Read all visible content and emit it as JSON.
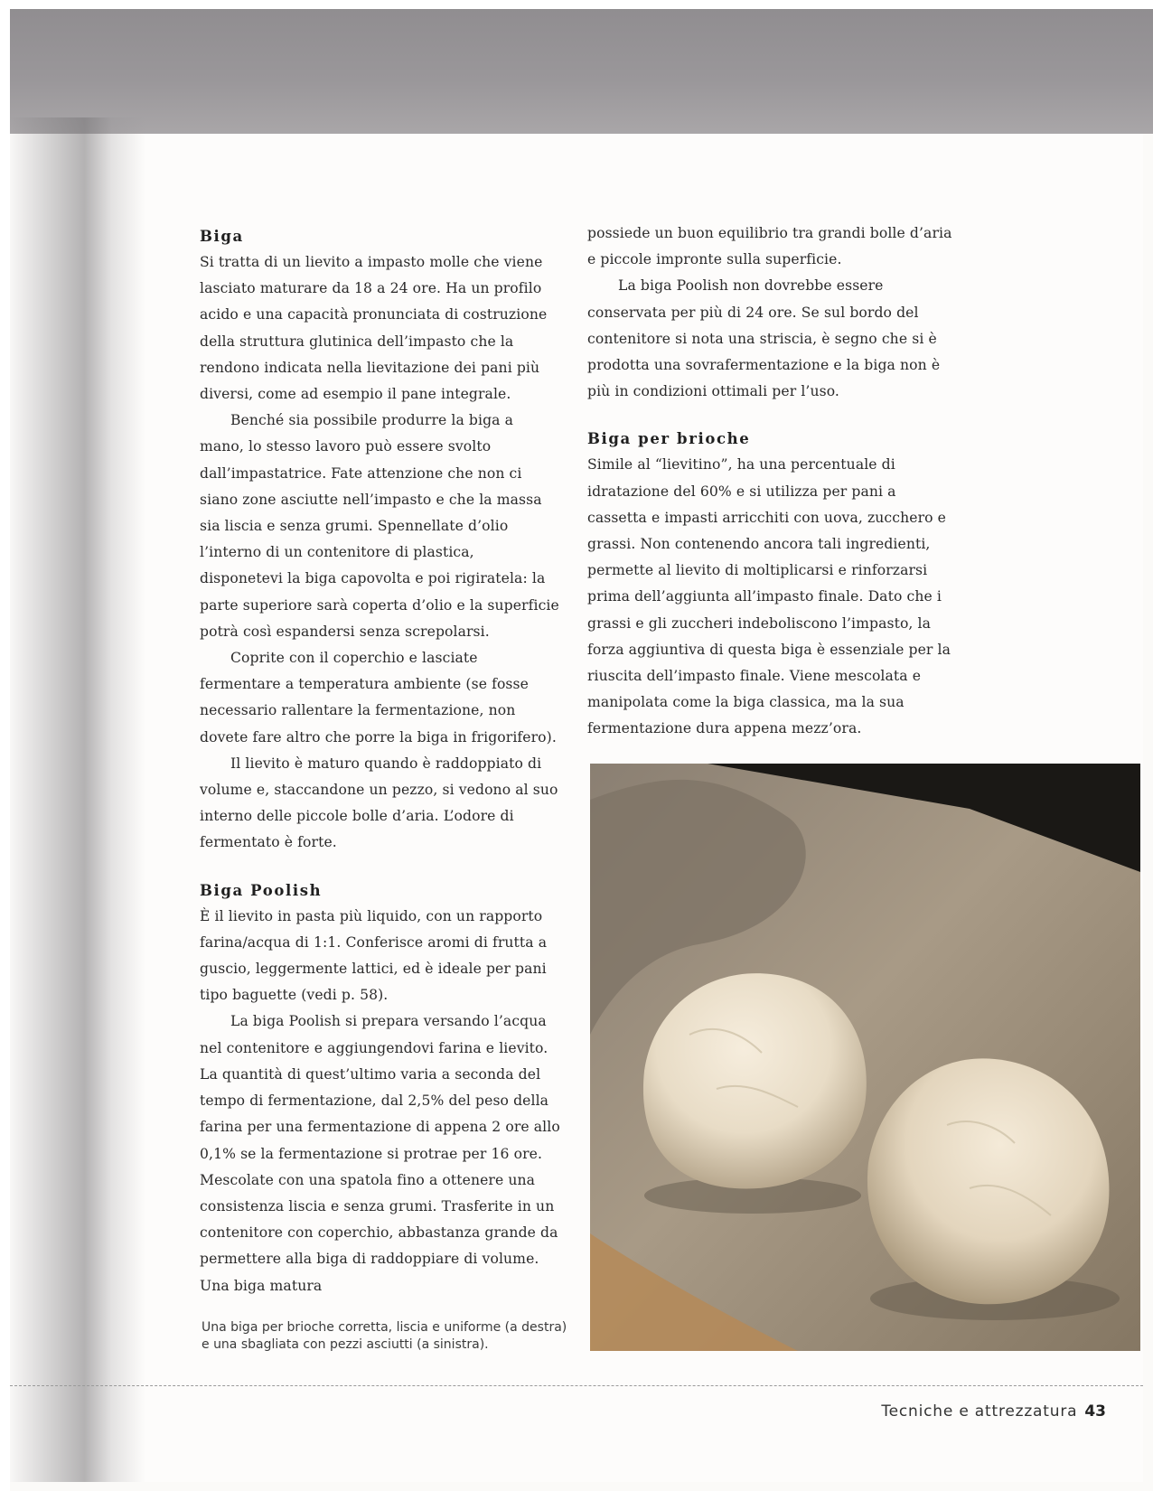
{
  "left_column": {
    "biga_heading": "Biga",
    "biga_p1": "Si tratta di un lievito a impasto molle che viene lasciato maturare da 18 a 24 ore. Ha un profilo acido e una capacità pronunciata di costruzione della struttura glutinica dell’impasto che la rendono indicata nella lievitazione dei pani più diversi, come ad esempio il pane integrale.",
    "biga_p2": "Benché sia possibile produrre la biga a mano, lo stesso lavoro può essere svolto dall’impastatrice. Fate attenzione che non ci siano zone asciutte nell’impasto e che la massa sia liscia e senza grumi. Spennellate d’olio l’interno di un contenitore di plastica, disponetevi la biga capovolta e poi rigiratela: la parte superiore sarà coperta d’olio e la superficie potrà così espandersi senza screpolarsi.",
    "biga_p3": "Coprite con il coperchio e lasciate fermentare a temperatura ambiente (se fosse necessario rallentare la fermentazione, non dovete fare altro che porre la biga in frigorifero).",
    "biga_p4": "Il lievito è maturo quando è raddoppiato di volume e, staccandone un pezzo, si vedono al suo interno delle piccole bolle d’aria. L’odore di fermentato è forte.",
    "poolish_heading": "Biga Poolish",
    "poolish_p1": "È il lievito in pasta più liquido, con un rapporto farina/acqua di 1:1. Conferisce aromi di frutta a guscio, leggermente lattici, ed è ideale per pani tipo baguette (vedi p. 58).",
    "poolish_p2": "La biga Poolish si prepara versando l’acqua nel contenitore e aggiungendovi farina e lievito. La quantità di quest’ultimo varia a seconda del tempo di fermentazione, dal 2,5% del peso della farina per una fermentazione di appena 2 ore allo 0,1% se la fermentazione si protrae per 16 ore. Mescolate con una spatola fino a ottenere una consistenza liscia e senza grumi. Trasferite in un contenitore con coperchio, abbastanza grande da permettere alla biga di raddoppiare di volume. Una biga matura"
  },
  "right_column": {
    "poolish_cont": "possiede un buon equilibrio tra grandi bolle d’aria e piccole impronte sulla superficie.",
    "poolish_p3": "La biga Poolish non dovrebbe essere conservata per più di 24 ore. Se sul bordo del contenitore si nota una striscia, è segno che si è prodotta una sovrafermentazione e la biga non è più in condizioni ottimali per l’uso.",
    "brioche_heading": "Biga per brioche",
    "brioche_p1": "Simile al “lievitino”, ha una percentuale di idratazione del 60% e si utilizza per pani a cassetta e impasti arricchiti con uova, zucchero e grassi. Non contenendo ancora tali ingredienti, permette al lievito di moltiplicarsi e rinforzarsi prima dell’aggiunta all’impasto finale. Dato che i grassi e gli zuccheri indeboliscono l’impasto, la forza aggiuntiva di questa biga è essenziale per la riuscita dell’impasto finale. Viene mescolata e manipolata come la biga classica, ma la sua fermentazione dura appena mezz’ora."
  },
  "caption": {
    "line1": "Una biga per brioche corretta, liscia e uniforme (a destra)",
    "line2": "e una sbagliata con pezzi asciutti (a sinistra)."
  },
  "footer": {
    "section": "Tecniche e attrezzatura",
    "page_number": "43"
  }
}
